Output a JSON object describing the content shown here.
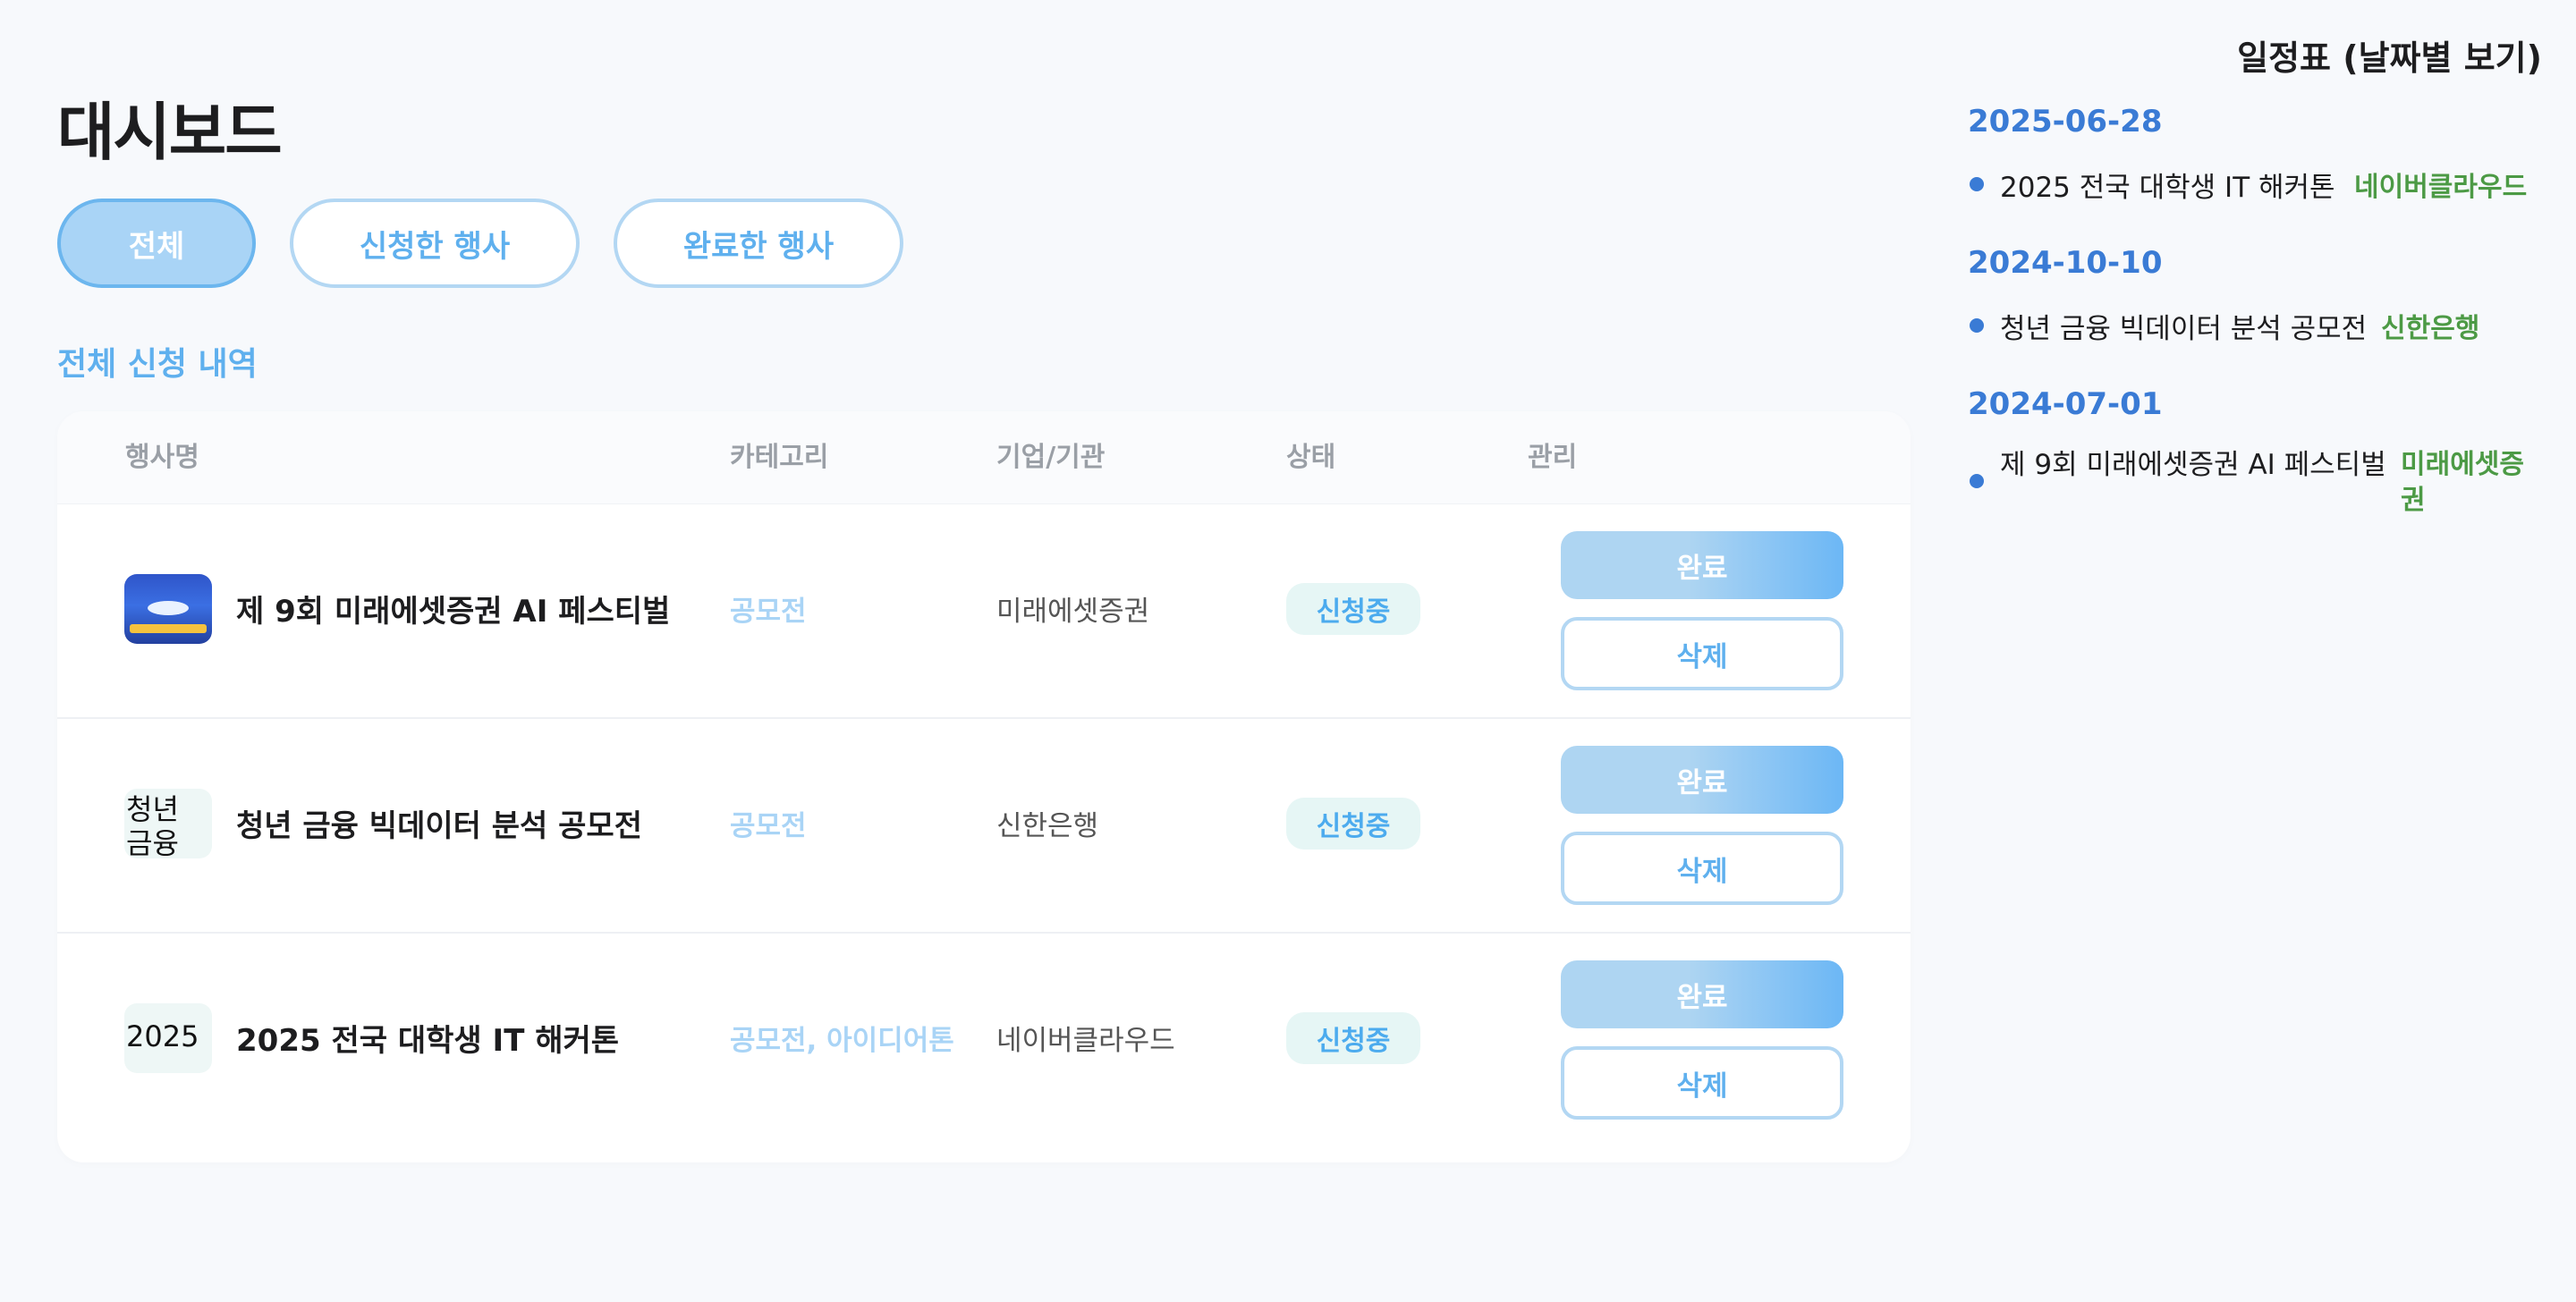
{
  "page": {
    "title": "대시보드"
  },
  "tabs": [
    {
      "label": "전체",
      "active": true
    },
    {
      "label": "신청한 행사",
      "active": false
    },
    {
      "label": "완료한 행사",
      "active": false
    }
  ],
  "section_title": "전체 신청 내역",
  "table": {
    "headers": [
      "행사명",
      "카테고리",
      "기업/기관",
      "상태",
      "관리"
    ],
    "rows": [
      {
        "thumbnail": "poster-image",
        "thumbnail_alt": "",
        "name": "제 9회 미래에셋증권 AI 페스티벌",
        "category": "공모전",
        "company": "미래에셋증권",
        "status": "신청중",
        "complete_label": "완료",
        "delete_label": "삭제"
      },
      {
        "thumbnail": "broken-image",
        "thumbnail_alt": "청년 금융",
        "name": "청년 금융 빅데이터 분석 공모전",
        "category": "공모전",
        "company": "신한은행",
        "status": "신청중",
        "complete_label": "완료",
        "delete_label": "삭제"
      },
      {
        "thumbnail": "broken-image",
        "thumbnail_alt": "2025",
        "name": "2025 전국 대학생 IT 해커톤",
        "category": "공모전, 아이디어톤",
        "company": "네이버클라우드",
        "status": "신청중",
        "complete_label": "완료",
        "delete_label": "삭제"
      }
    ]
  },
  "schedule": {
    "title": "일정표 (날짜별 보기)",
    "groups": [
      {
        "date": "2025-06-28",
        "items": [
          {
            "name": "2025 전국 대학생 IT 해커톤",
            "org": "네이버클라우드"
          }
        ]
      },
      {
        "date": "2024-10-10",
        "items": [
          {
            "name": "청년 금융 빅데이터 분석 공모전",
            "org": "신한은행"
          }
        ]
      },
      {
        "date": "2024-07-01",
        "items": [
          {
            "name": "제 9회 미래에셋증권 AI 페스티벌",
            "org": "미래에셋증권"
          }
        ]
      }
    ]
  },
  "colors": {
    "accent": "#5fb0ee",
    "accent_light": "#a9d4f6",
    "date_blue": "#3a7bd5",
    "org_green": "#4c9a45",
    "status_bg": "#e6f6f5"
  }
}
